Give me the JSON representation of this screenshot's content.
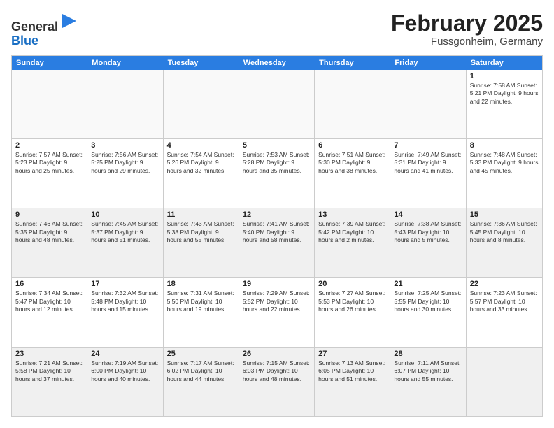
{
  "logo": {
    "general": "General",
    "blue": "Blue"
  },
  "title": "February 2025",
  "location": "Fussgonheim, Germany",
  "header_days": [
    "Sunday",
    "Monday",
    "Tuesday",
    "Wednesday",
    "Thursday",
    "Friday",
    "Saturday"
  ],
  "rows": [
    [
      {
        "day": "",
        "info": "",
        "empty": true
      },
      {
        "day": "",
        "info": "",
        "empty": true
      },
      {
        "day": "",
        "info": "",
        "empty": true
      },
      {
        "day": "",
        "info": "",
        "empty": true
      },
      {
        "day": "",
        "info": "",
        "empty": true
      },
      {
        "day": "",
        "info": "",
        "empty": true
      },
      {
        "day": "1",
        "info": "Sunrise: 7:58 AM\nSunset: 5:21 PM\nDaylight: 9 hours\nand 22 minutes."
      }
    ],
    [
      {
        "day": "2",
        "info": "Sunrise: 7:57 AM\nSunset: 5:23 PM\nDaylight: 9 hours\nand 25 minutes."
      },
      {
        "day": "3",
        "info": "Sunrise: 7:56 AM\nSunset: 5:25 PM\nDaylight: 9 hours\nand 29 minutes."
      },
      {
        "day": "4",
        "info": "Sunrise: 7:54 AM\nSunset: 5:26 PM\nDaylight: 9 hours\nand 32 minutes."
      },
      {
        "day": "5",
        "info": "Sunrise: 7:53 AM\nSunset: 5:28 PM\nDaylight: 9 hours\nand 35 minutes."
      },
      {
        "day": "6",
        "info": "Sunrise: 7:51 AM\nSunset: 5:30 PM\nDaylight: 9 hours\nand 38 minutes."
      },
      {
        "day": "7",
        "info": "Sunrise: 7:49 AM\nSunset: 5:31 PM\nDaylight: 9 hours\nand 41 minutes."
      },
      {
        "day": "8",
        "info": "Sunrise: 7:48 AM\nSunset: 5:33 PM\nDaylight: 9 hours\nand 45 minutes."
      }
    ],
    [
      {
        "day": "9",
        "info": "Sunrise: 7:46 AM\nSunset: 5:35 PM\nDaylight: 9 hours\nand 48 minutes.",
        "shaded": true
      },
      {
        "day": "10",
        "info": "Sunrise: 7:45 AM\nSunset: 5:37 PM\nDaylight: 9 hours\nand 51 minutes.",
        "shaded": true
      },
      {
        "day": "11",
        "info": "Sunrise: 7:43 AM\nSunset: 5:38 PM\nDaylight: 9 hours\nand 55 minutes.",
        "shaded": true
      },
      {
        "day": "12",
        "info": "Sunrise: 7:41 AM\nSunset: 5:40 PM\nDaylight: 9 hours\nand 58 minutes.",
        "shaded": true
      },
      {
        "day": "13",
        "info": "Sunrise: 7:39 AM\nSunset: 5:42 PM\nDaylight: 10 hours\nand 2 minutes.",
        "shaded": true
      },
      {
        "day": "14",
        "info": "Sunrise: 7:38 AM\nSunset: 5:43 PM\nDaylight: 10 hours\nand 5 minutes.",
        "shaded": true
      },
      {
        "day": "15",
        "info": "Sunrise: 7:36 AM\nSunset: 5:45 PM\nDaylight: 10 hours\nand 8 minutes.",
        "shaded": true
      }
    ],
    [
      {
        "day": "16",
        "info": "Sunrise: 7:34 AM\nSunset: 5:47 PM\nDaylight: 10 hours\nand 12 minutes."
      },
      {
        "day": "17",
        "info": "Sunrise: 7:32 AM\nSunset: 5:48 PM\nDaylight: 10 hours\nand 15 minutes."
      },
      {
        "day": "18",
        "info": "Sunrise: 7:31 AM\nSunset: 5:50 PM\nDaylight: 10 hours\nand 19 minutes."
      },
      {
        "day": "19",
        "info": "Sunrise: 7:29 AM\nSunset: 5:52 PM\nDaylight: 10 hours\nand 22 minutes."
      },
      {
        "day": "20",
        "info": "Sunrise: 7:27 AM\nSunset: 5:53 PM\nDaylight: 10 hours\nand 26 minutes."
      },
      {
        "day": "21",
        "info": "Sunrise: 7:25 AM\nSunset: 5:55 PM\nDaylight: 10 hours\nand 30 minutes."
      },
      {
        "day": "22",
        "info": "Sunrise: 7:23 AM\nSunset: 5:57 PM\nDaylight: 10 hours\nand 33 minutes."
      }
    ],
    [
      {
        "day": "23",
        "info": "Sunrise: 7:21 AM\nSunset: 5:58 PM\nDaylight: 10 hours\nand 37 minutes.",
        "shaded": true
      },
      {
        "day": "24",
        "info": "Sunrise: 7:19 AM\nSunset: 6:00 PM\nDaylight: 10 hours\nand 40 minutes.",
        "shaded": true
      },
      {
        "day": "25",
        "info": "Sunrise: 7:17 AM\nSunset: 6:02 PM\nDaylight: 10 hours\nand 44 minutes.",
        "shaded": true
      },
      {
        "day": "26",
        "info": "Sunrise: 7:15 AM\nSunset: 6:03 PM\nDaylight: 10 hours\nand 48 minutes.",
        "shaded": true
      },
      {
        "day": "27",
        "info": "Sunrise: 7:13 AM\nSunset: 6:05 PM\nDaylight: 10 hours\nand 51 minutes.",
        "shaded": true
      },
      {
        "day": "28",
        "info": "Sunrise: 7:11 AM\nSunset: 6:07 PM\nDaylight: 10 hours\nand 55 minutes.",
        "shaded": true
      },
      {
        "day": "",
        "info": "",
        "empty": true,
        "shaded": true
      }
    ]
  ]
}
